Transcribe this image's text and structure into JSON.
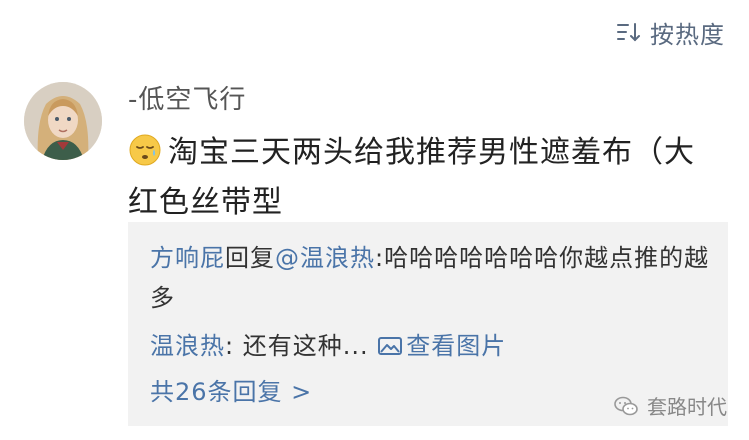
{
  "sort": {
    "label": "按热度"
  },
  "comment": {
    "username": "-低空飞行",
    "text": "淘宝三天两头给我推荐男性遮羞布（大红色丝带型"
  },
  "replies": [
    {
      "author": "方响屁",
      "action": "回复",
      "target": "@温浪热",
      "sep": ":",
      "text": "哈哈哈哈哈哈哈你越点推的越多"
    },
    {
      "author": "温浪热",
      "sep": ":",
      "text": " 还有这种... ",
      "image_link": "查看图片"
    }
  ],
  "more_replies": "共26条回复 >",
  "watermark": "套路时代",
  "colors": {
    "link": "#4a74a8",
    "reply_bg": "#f2f2f2"
  },
  "icons": [
    "sort-icon",
    "sleepy-emoji-icon",
    "image-icon",
    "wechat-icon"
  ]
}
